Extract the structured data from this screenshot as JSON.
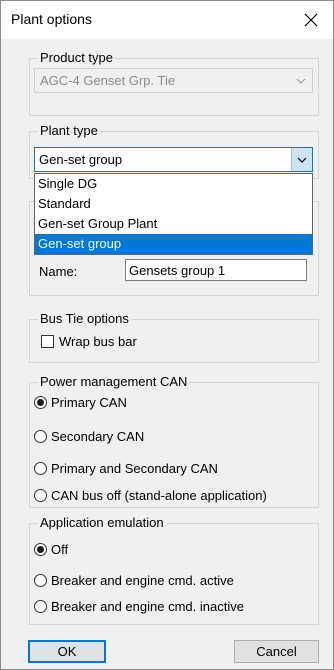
{
  "window": {
    "title": "Plant options"
  },
  "product_type": {
    "group_label": "Product type",
    "selected": "AGC-4 Genset Grp. Tie"
  },
  "plant_type": {
    "group_label": "Plant type",
    "selected": "Gen-set group",
    "options": [
      "Single DG",
      "Standard",
      "Gen-set Group Plant",
      "Gen-set group"
    ],
    "selected_index": 3
  },
  "name": {
    "label": "Name:",
    "value": "Gensets group 1"
  },
  "bus_tie": {
    "group_label": "Bus Tie options",
    "wrap_bus_bar_label": "Wrap bus bar",
    "wrap_bus_bar_checked": false
  },
  "power_mgmt_can": {
    "group_label": "Power management CAN",
    "options": [
      "Primary CAN",
      "Secondary CAN",
      "Primary and Secondary CAN",
      "CAN bus off (stand-alone application)"
    ],
    "selected_index": 0
  },
  "app_emulation": {
    "group_label": "Application emulation",
    "options": [
      "Off",
      "Breaker and engine cmd. active",
      "Breaker and engine cmd. inactive"
    ],
    "selected_index": 0
  },
  "buttons": {
    "ok": "OK",
    "cancel": "Cancel"
  },
  "icons": {
    "close": "close-icon",
    "combo_arrow": "chevron-down-icon"
  }
}
